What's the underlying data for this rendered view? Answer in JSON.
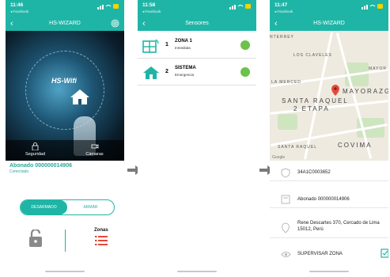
{
  "screen1": {
    "status_time": "11:46",
    "status_back": "◂ Facebook",
    "title": "HS-WIZARD",
    "hero_label": "HS-Wifi",
    "tabs": [
      "Seguridad",
      "Cámaras"
    ],
    "subscriber": "Abonado 000000014906",
    "connection": "Conectado",
    "toggle_on": "DESARMADO",
    "toggle_off": "ARMAR",
    "zones_label": "Zonas"
  },
  "screen2": {
    "status_time": "11:58",
    "status_back": "◂ Facebook",
    "title": "Sensores",
    "sensors": [
      {
        "number": "1",
        "name": "ZONA 1",
        "type": "Inmediata",
        "status_color": "#6cc24a"
      },
      {
        "number": "2",
        "name": "SISTEMA",
        "type": "Emergencia",
        "status_color": "#6cc24a"
      }
    ]
  },
  "screen3": {
    "status_time": "11:47",
    "status_back": "◂ Facebook",
    "title": "HS-WIZARD",
    "map_labels": [
      "NTERREY",
      "LOS CLAVELES",
      "LA MERCED",
      "SANTA RAQUEL",
      "2 ETAPA",
      "MAYORAZGO",
      "SANTA RAQUEL",
      "COVIMA",
      "MAYOR"
    ],
    "map_footer": "Google",
    "device_id": "34A1C0003652",
    "subscriber": "Abonado 000000014906",
    "address": "Rene Descartes 370, Cercado de Lima 15012, Perú",
    "supervise": "SUPERVISAR ZONA"
  },
  "colors": {
    "accent": "#1fb5a6",
    "status_ok": "#6cc24a",
    "alarm_red": "#e34a3b"
  }
}
